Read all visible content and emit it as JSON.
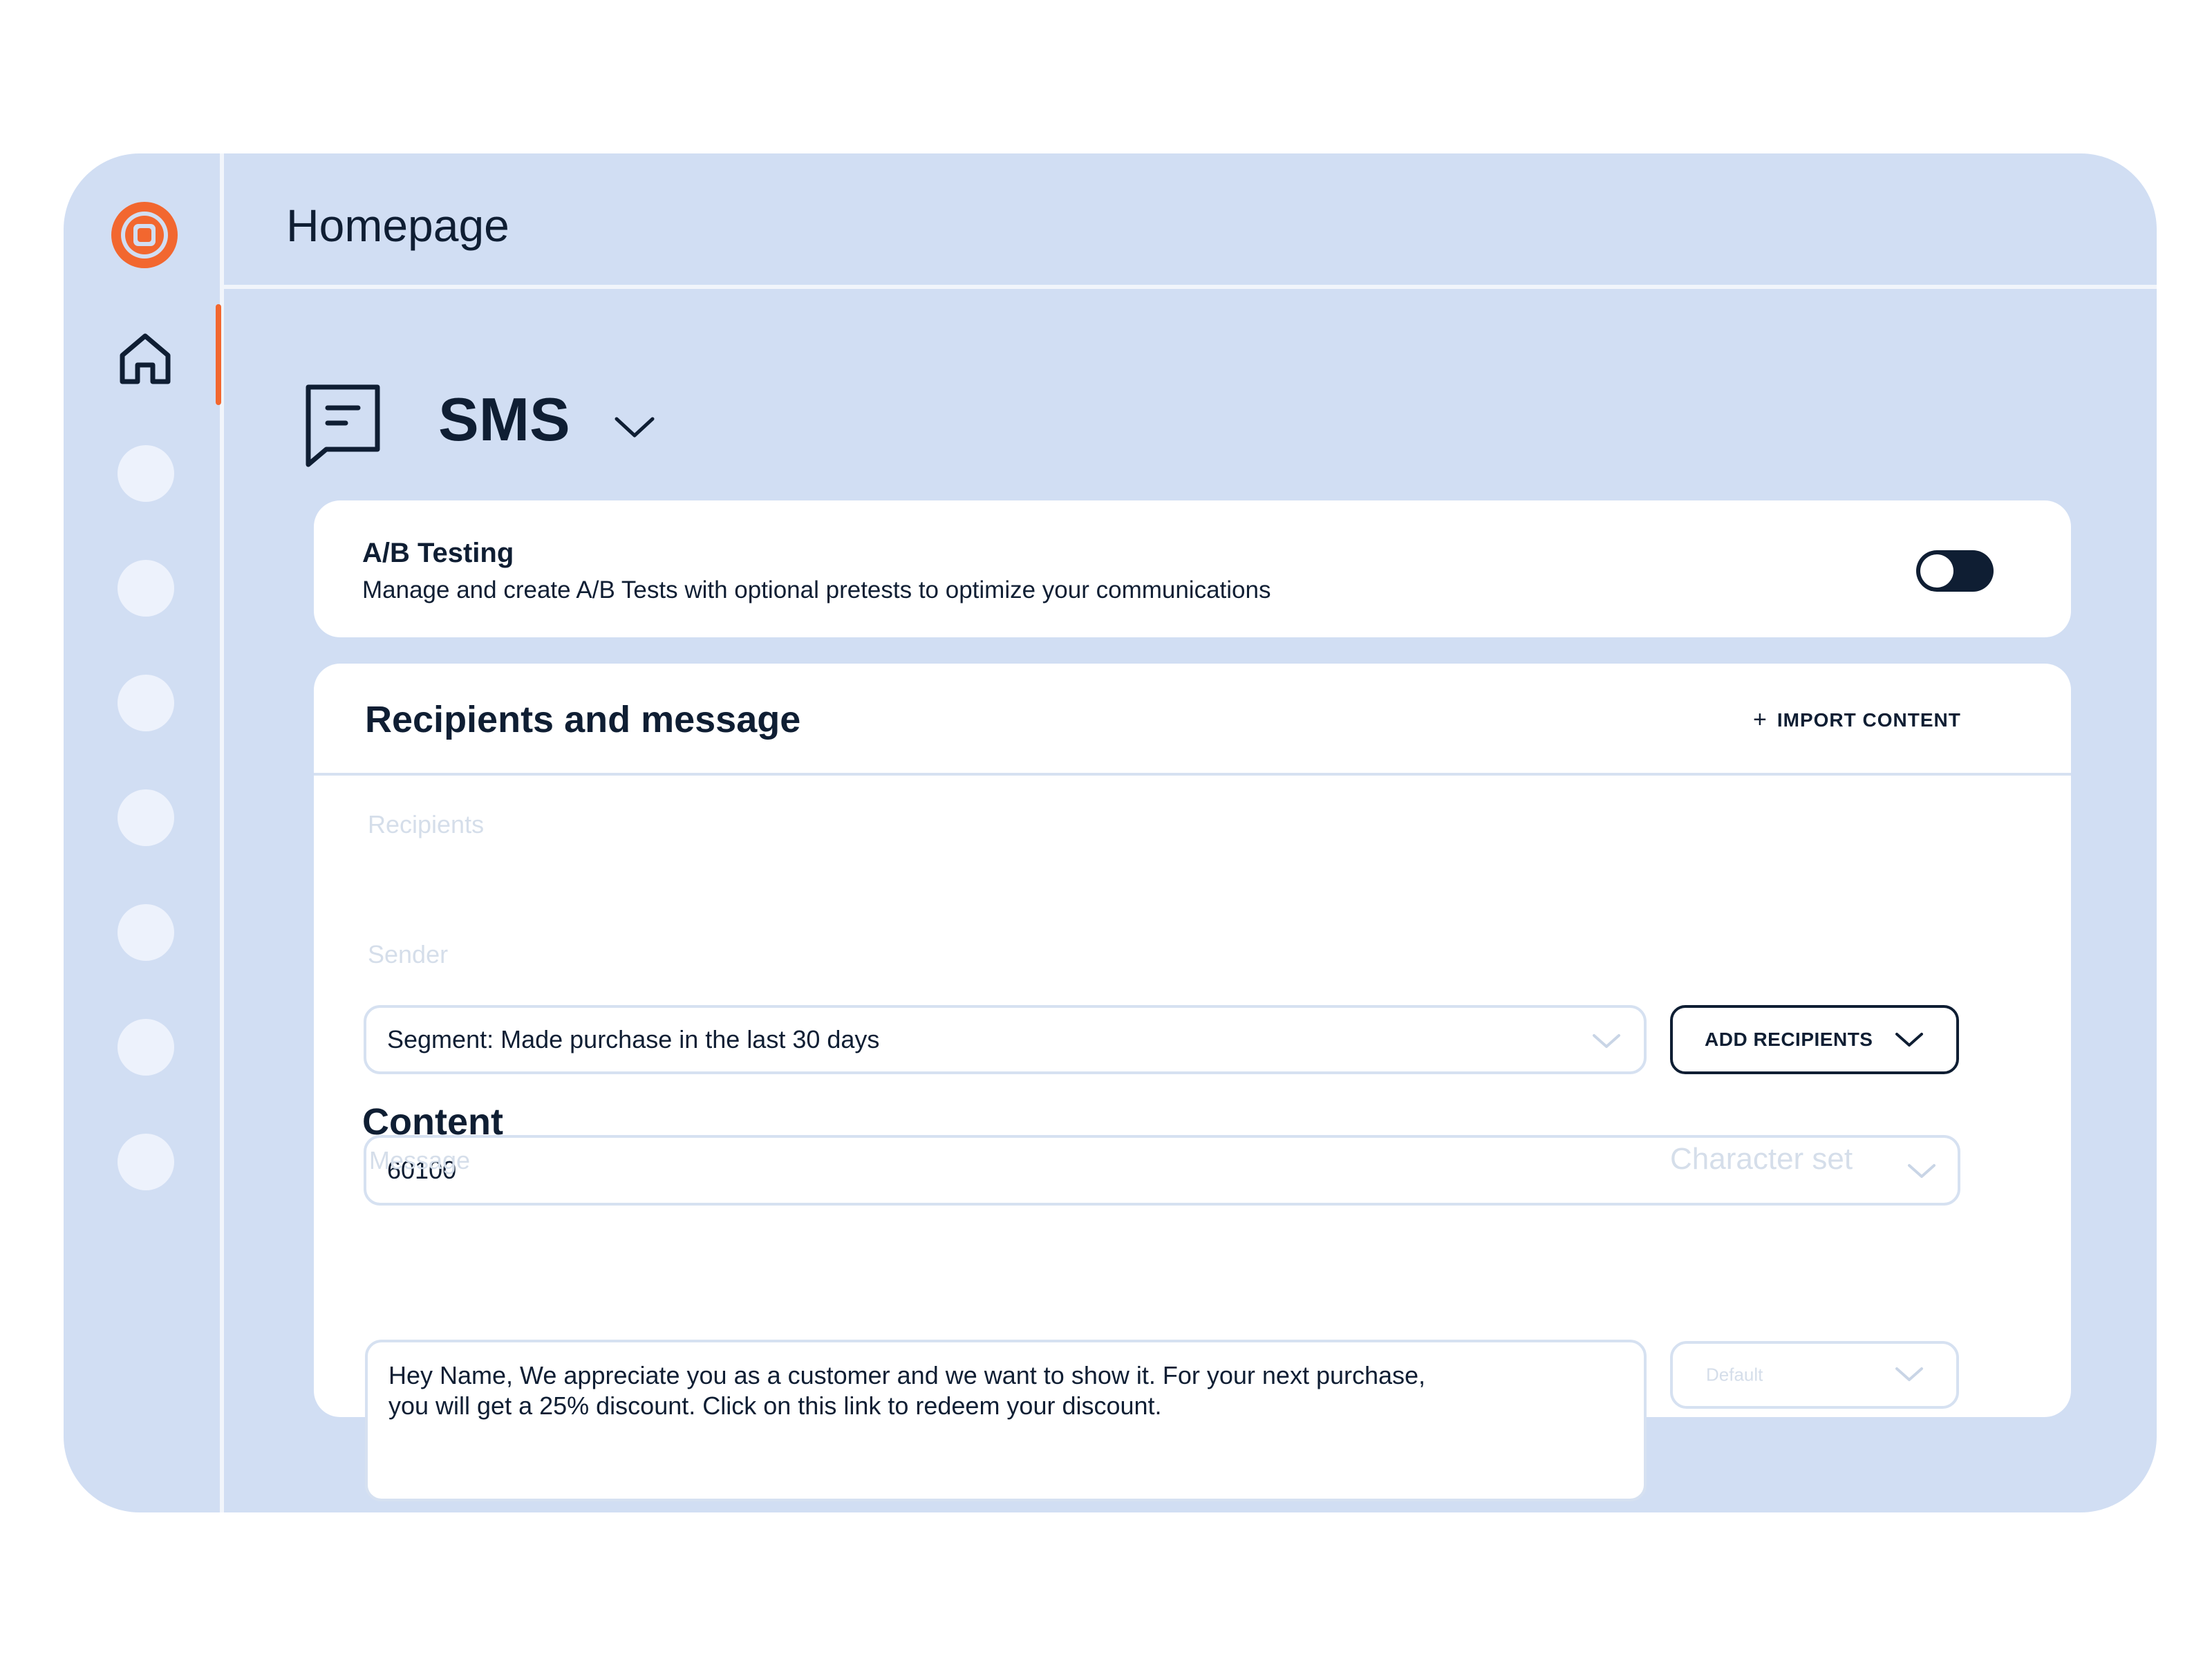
{
  "brand": {
    "logo_icon": "concentric-square-logo-icon",
    "accent_color": "#f2672f",
    "dark_color": "#0f1e33",
    "frame_color": "#d1def3"
  },
  "sidebar": {
    "home_icon": "home-icon",
    "placeholder_items": 7
  },
  "header": {
    "title": "Homepage"
  },
  "channel": {
    "icon": "chat-message-icon",
    "label": "SMS"
  },
  "ab_testing": {
    "title": "A/B Testing",
    "description": "Manage and create A/B Tests with optional pretests to optimize your communications",
    "enabled": true
  },
  "recipients_card": {
    "title": "Recipients and message",
    "import_label": "IMPORT CONTENT",
    "recipients_label": "Recipients",
    "recipients_value": "Segment: Made purchase in the last 30 days",
    "add_recipients_label": "ADD RECIPIENTS",
    "sender_label": "Sender",
    "sender_value": "60100",
    "content_title": "Content",
    "message_label": "Message",
    "message_text": "Hey Name, We appreciate you as a customer and we want to show it. For your next purchase,\nyou will get a 25% discount. Click on this link to redeem your discount.",
    "charset_label": "Character set",
    "charset_placeholder": "Default"
  }
}
